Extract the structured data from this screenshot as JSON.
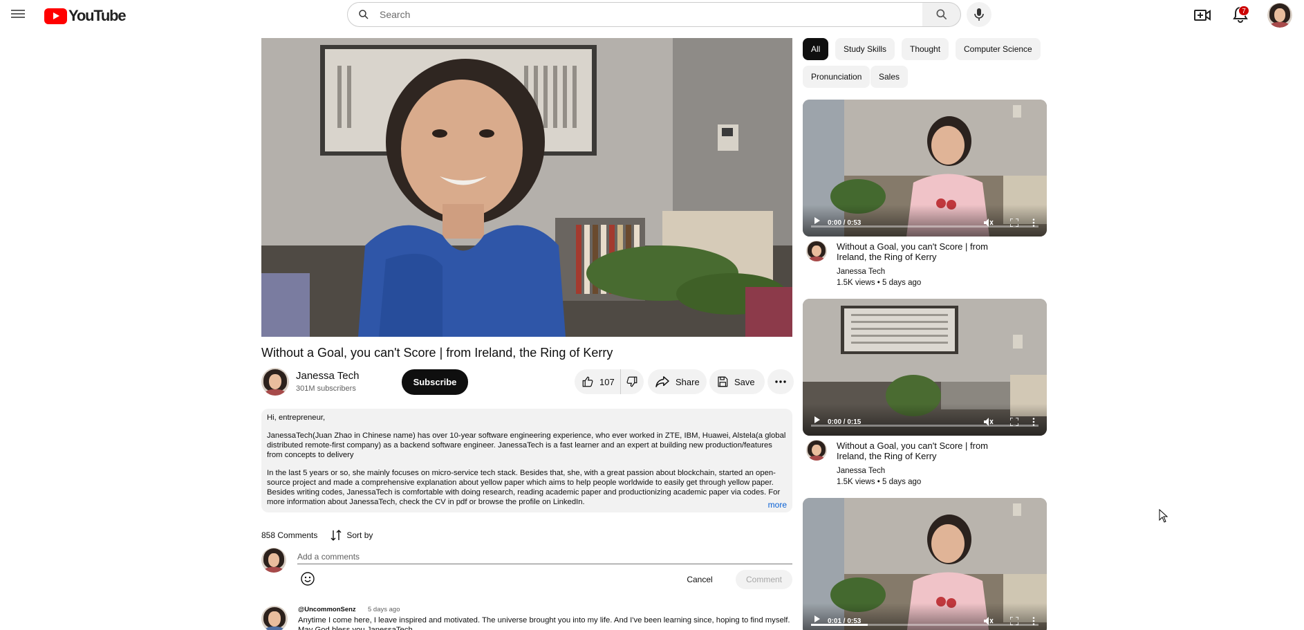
{
  "header": {
    "logo_text": "YouTube",
    "search_placeholder": "Search",
    "notification_count": "7"
  },
  "video": {
    "title": "Without a Goal, you can't Score | from Ireland, the Ring of Kerry",
    "channel_name": "Janessa Tech",
    "subscribers": "301M subscribers",
    "subscribe_label": "Subscribe",
    "like_count": "107",
    "share_label": "Share",
    "save_label": "Save"
  },
  "description": {
    "paragraphs": [
      "Hi, entrepreneur,",
      "JanessaTech(Juan Zhao in Chinese name) has over 10-year software engineering experience, who ever worked in ZTE, IBM, Huawei, Alstela(a global distributed remote-first company) as a backend software engineer. JanessaTech is a fast learner and an expert at building new production/features from concepts to delivery",
      "In the last 5 years or so, she mainly focuses on micro-service tech stack. Besides that, she, with a great passion about blockchain, started an open-source project and made a comprehensive explanation about yellow paper which aims to help people worldwide to easily get through yellow paper. Besides writing codes, JanessaTech is comfortable with doing research, reading academic paper and productionizing academic paper via codes. For more information about JanessaTech, check the CV in pdf or browse the profile on LinkedIn."
    ],
    "more_label": "more"
  },
  "comments": {
    "count_label": "858 Comments",
    "sort_label": "Sort by",
    "input_placeholder": "Add a comments",
    "cancel_label": "Cancel",
    "comment_label": "Comment",
    "items": [
      {
        "author": "@UncommonSenz",
        "time": "5 days ago",
        "text": "Anytime I come here, I leave inspired and motivated. The universe brought you into my life. And I've been learning since, hoping to find myself. May God bless you JanessaTech"
      }
    ]
  },
  "chips": [
    "All",
    "Study Skills",
    "Thought",
    "Computer Science",
    "Pronunciation",
    "Sales"
  ],
  "recommended": [
    {
      "time": "0:00 / 0:53",
      "progress": 0,
      "title": "Without a Goal, you can't Score | from Ireland, the Ring of Kerry",
      "channel": "Janessa Tech",
      "meta": "1.5K views • 5 days ago"
    },
    {
      "time": "0:00 / 0:15",
      "progress": 0,
      "title": "Without a Goal, you can't Score | from Ireland, the Ring of Kerry",
      "channel": "Janessa Tech",
      "meta": "1.5K views • 5 days ago"
    },
    {
      "time": "0:01 / 0:53",
      "progress": 0.25
    }
  ],
  "colors": {
    "brand_red": "#ff0000",
    "link_blue": "#065fd4",
    "chip_bg": "#f2f2f2",
    "chip_active_bg": "#0f0f0f"
  }
}
